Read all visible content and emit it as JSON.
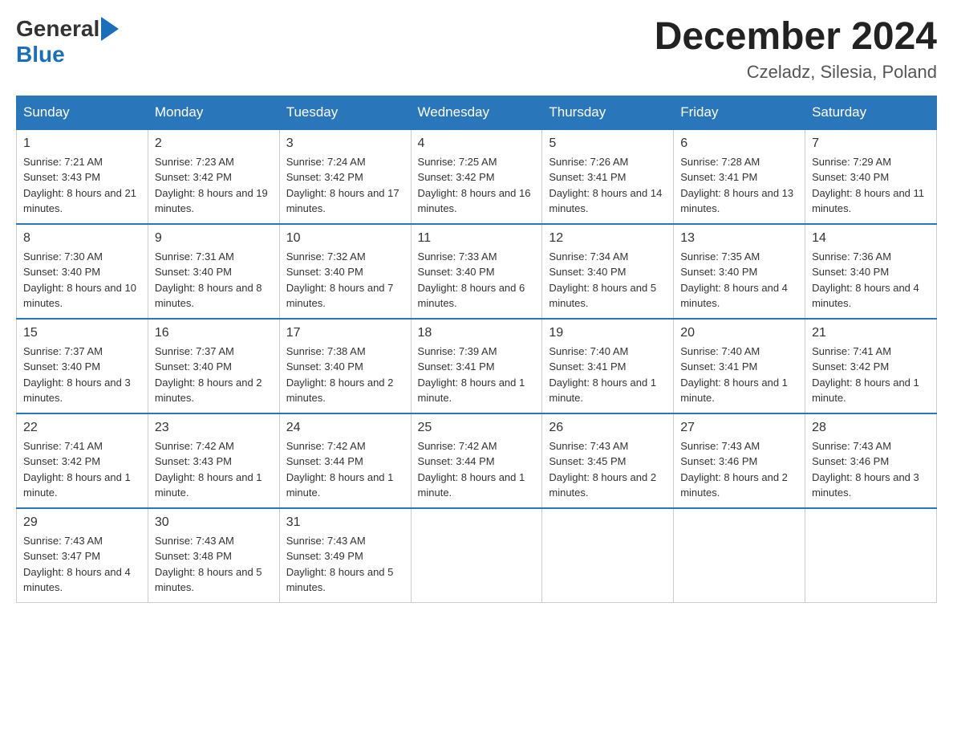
{
  "logo": {
    "general": "General",
    "blue": "Blue",
    "arrow": "▶"
  },
  "title": "December 2024",
  "location": "Czeladz, Silesia, Poland",
  "days_of_week": [
    "Sunday",
    "Monday",
    "Tuesday",
    "Wednesday",
    "Thursday",
    "Friday",
    "Saturday"
  ],
  "weeks": [
    [
      {
        "day": "1",
        "sunrise": "7:21 AM",
        "sunset": "3:43 PM",
        "daylight": "8 hours and 21 minutes."
      },
      {
        "day": "2",
        "sunrise": "7:23 AM",
        "sunset": "3:42 PM",
        "daylight": "8 hours and 19 minutes."
      },
      {
        "day": "3",
        "sunrise": "7:24 AM",
        "sunset": "3:42 PM",
        "daylight": "8 hours and 17 minutes."
      },
      {
        "day": "4",
        "sunrise": "7:25 AM",
        "sunset": "3:42 PM",
        "daylight": "8 hours and 16 minutes."
      },
      {
        "day": "5",
        "sunrise": "7:26 AM",
        "sunset": "3:41 PM",
        "daylight": "8 hours and 14 minutes."
      },
      {
        "day": "6",
        "sunrise": "7:28 AM",
        "sunset": "3:41 PM",
        "daylight": "8 hours and 13 minutes."
      },
      {
        "day": "7",
        "sunrise": "7:29 AM",
        "sunset": "3:40 PM",
        "daylight": "8 hours and 11 minutes."
      }
    ],
    [
      {
        "day": "8",
        "sunrise": "7:30 AM",
        "sunset": "3:40 PM",
        "daylight": "8 hours and 10 minutes."
      },
      {
        "day": "9",
        "sunrise": "7:31 AM",
        "sunset": "3:40 PM",
        "daylight": "8 hours and 8 minutes."
      },
      {
        "day": "10",
        "sunrise": "7:32 AM",
        "sunset": "3:40 PM",
        "daylight": "8 hours and 7 minutes."
      },
      {
        "day": "11",
        "sunrise": "7:33 AM",
        "sunset": "3:40 PM",
        "daylight": "8 hours and 6 minutes."
      },
      {
        "day": "12",
        "sunrise": "7:34 AM",
        "sunset": "3:40 PM",
        "daylight": "8 hours and 5 minutes."
      },
      {
        "day": "13",
        "sunrise": "7:35 AM",
        "sunset": "3:40 PM",
        "daylight": "8 hours and 4 minutes."
      },
      {
        "day": "14",
        "sunrise": "7:36 AM",
        "sunset": "3:40 PM",
        "daylight": "8 hours and 4 minutes."
      }
    ],
    [
      {
        "day": "15",
        "sunrise": "7:37 AM",
        "sunset": "3:40 PM",
        "daylight": "8 hours and 3 minutes."
      },
      {
        "day": "16",
        "sunrise": "7:37 AM",
        "sunset": "3:40 PM",
        "daylight": "8 hours and 2 minutes."
      },
      {
        "day": "17",
        "sunrise": "7:38 AM",
        "sunset": "3:40 PM",
        "daylight": "8 hours and 2 minutes."
      },
      {
        "day": "18",
        "sunrise": "7:39 AM",
        "sunset": "3:41 PM",
        "daylight": "8 hours and 1 minute."
      },
      {
        "day": "19",
        "sunrise": "7:40 AM",
        "sunset": "3:41 PM",
        "daylight": "8 hours and 1 minute."
      },
      {
        "day": "20",
        "sunrise": "7:40 AM",
        "sunset": "3:41 PM",
        "daylight": "8 hours and 1 minute."
      },
      {
        "day": "21",
        "sunrise": "7:41 AM",
        "sunset": "3:42 PM",
        "daylight": "8 hours and 1 minute."
      }
    ],
    [
      {
        "day": "22",
        "sunrise": "7:41 AM",
        "sunset": "3:42 PM",
        "daylight": "8 hours and 1 minute."
      },
      {
        "day": "23",
        "sunrise": "7:42 AM",
        "sunset": "3:43 PM",
        "daylight": "8 hours and 1 minute."
      },
      {
        "day": "24",
        "sunrise": "7:42 AM",
        "sunset": "3:44 PM",
        "daylight": "8 hours and 1 minute."
      },
      {
        "day": "25",
        "sunrise": "7:42 AM",
        "sunset": "3:44 PM",
        "daylight": "8 hours and 1 minute."
      },
      {
        "day": "26",
        "sunrise": "7:43 AM",
        "sunset": "3:45 PM",
        "daylight": "8 hours and 2 minutes."
      },
      {
        "day": "27",
        "sunrise": "7:43 AM",
        "sunset": "3:46 PM",
        "daylight": "8 hours and 2 minutes."
      },
      {
        "day": "28",
        "sunrise": "7:43 AM",
        "sunset": "3:46 PM",
        "daylight": "8 hours and 3 minutes."
      }
    ],
    [
      {
        "day": "29",
        "sunrise": "7:43 AM",
        "sunset": "3:47 PM",
        "daylight": "8 hours and 4 minutes."
      },
      {
        "day": "30",
        "sunrise": "7:43 AM",
        "sunset": "3:48 PM",
        "daylight": "8 hours and 5 minutes."
      },
      {
        "day": "31",
        "sunrise": "7:43 AM",
        "sunset": "3:49 PM",
        "daylight": "8 hours and 5 minutes."
      },
      null,
      null,
      null,
      null
    ]
  ],
  "labels": {
    "sunrise": "Sunrise:",
    "sunset": "Sunset:",
    "daylight": "Daylight:"
  }
}
